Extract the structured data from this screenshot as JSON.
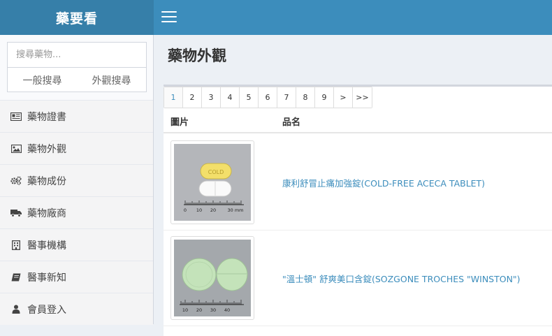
{
  "app": {
    "title": "藥要看"
  },
  "search": {
    "placeholder": "搜尋藥物...",
    "general_label": "一般搜尋",
    "appearance_label": "外觀搜尋"
  },
  "sidebar": {
    "items": [
      {
        "label": "藥物證書",
        "icon": "newspaper-icon"
      },
      {
        "label": "藥物外觀",
        "icon": "image-icon"
      },
      {
        "label": "藥物成份",
        "icon": "gears-icon"
      },
      {
        "label": "藥物廠商",
        "icon": "truck-icon"
      },
      {
        "label": "醫事機構",
        "icon": "building-icon"
      },
      {
        "label": "醫事新知",
        "icon": "book-icon"
      },
      {
        "label": "會員登入",
        "icon": "user-icon"
      }
    ]
  },
  "page": {
    "title": "藥物外觀"
  },
  "pagination": {
    "pages": [
      "1",
      "2",
      "3",
      "4",
      "5",
      "6",
      "7",
      "8",
      "9",
      ">",
      ">>"
    ],
    "active": "1"
  },
  "table": {
    "headers": {
      "image": "圖片",
      "name": "品名"
    },
    "rows": [
      {
        "name": "康利舒冒止痛加強錠(COLD-FREE ACECA TABLET)",
        "scale": [
          "0",
          "10",
          "20",
          "30 mm"
        ],
        "imprint": "COLD"
      },
      {
        "name": "\"溫士頓\" 舒爽美口含錠(SOZGONE TROCHES \"WINSTON\")",
        "scale": [
          "10",
          "20",
          "30",
          "40"
        ],
        "imprint": ""
      }
    ]
  },
  "colors": {
    "header": "#3c8dbc",
    "logo_bg": "#367fa9",
    "link": "#3c8dbc"
  }
}
